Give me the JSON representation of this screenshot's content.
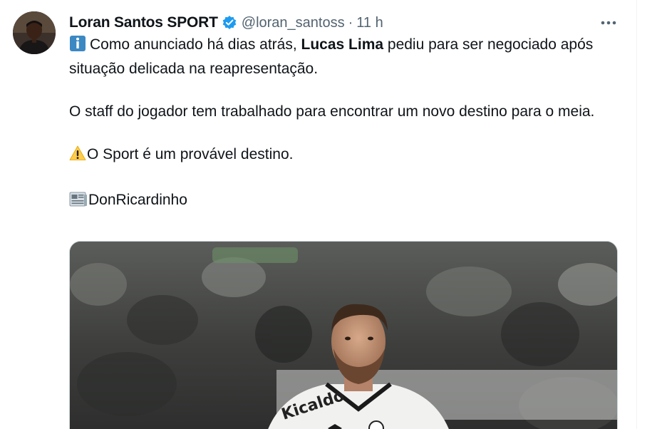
{
  "author": {
    "display_name": "Loran Santos SPORT",
    "handle": "@loran_santoss",
    "separator": "·",
    "timestamp": "11 h",
    "verified": true,
    "verified_color": "#1d9bf0"
  },
  "menu_icon": "more-horizontal-icon",
  "tweet": {
    "line1_pre": "Como anunciado há dias atrás, ",
    "line1_bold": "Lucas Lima",
    "line1_post": " pediu para ser negociado após situação delicada na reapresentação.",
    "para2": "O staff do jogador tem trabalhado para encontrar um novo destino para o meia.",
    "para3": "O Sport é um provável destino.",
    "para4": "DonRicardinho",
    "emoji1": "info-icon",
    "emoji2": "warning-icon",
    "emoji3": "newspaper-icon"
  },
  "media": {
    "jersey_text": "Kicaldo"
  }
}
